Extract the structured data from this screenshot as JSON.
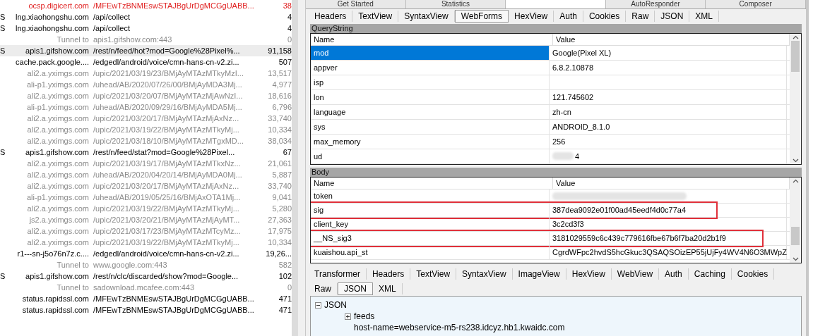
{
  "sessions": [
    {
      "host": "ocsp.digicert.com",
      "url": "/MFEwTzBNMEswSTAJBgUrDgMCGgUABB...",
      "column_4": "38",
      "kind": "error",
      "selected": false
    },
    {
      "column_1": "S",
      "host": "lng.xiaohongshu.com",
      "url": "/api/collect",
      "column_4": "4",
      "kind": "normal",
      "selected": false
    },
    {
      "column_1": "S",
      "host": "lng.xiaohongshu.com",
      "url": "/api/collect",
      "column_4": "4",
      "kind": "normal",
      "selected": false
    },
    {
      "host": "Tunnel to",
      "url": "apis1.gifshow.com:443",
      "column_4": "0",
      "kind": "tunnel",
      "selected": false
    },
    {
      "column_1": "S",
      "host": "apis1.gifshow.com",
      "url": "/rest/n/feed/hot?mod=Google%28Pixel%...",
      "column_4": "91,158",
      "kind": "normal",
      "selected": true
    },
    {
      "host": "cache.pack.google....",
      "url": "/edgedl/android/voice/cmn-hans-cn-v2.zi...",
      "column_4": "507",
      "kind": "normal",
      "selected": false
    },
    {
      "host": "ali2.a.yximgs.com",
      "url": "/upic/2021/03/19/23/BMjAyMTAzMTkyMzI...",
      "column_4": "13,517",
      "kind": "image",
      "selected": false
    },
    {
      "host": "ali-p1.yximgs.com",
      "url": "/uhead/AB/2020/07/26/00/BMjAyMDA3Mj...",
      "column_4": "4,977",
      "kind": "image",
      "selected": false
    },
    {
      "host": "ali2.a.yximgs.com",
      "url": "/upic/2021/03/20/07/BMjAyMTAzMjAwNzI...",
      "column_4": "18,616",
      "kind": "image",
      "selected": false
    },
    {
      "host": "ali-p1.yximgs.com",
      "url": "/uhead/AB/2020/09/29/16/BMjAyMDA5Mj...",
      "column_4": "6,796",
      "kind": "image",
      "selected": false
    },
    {
      "host": "ali2.a.yximgs.com",
      "url": "/upic/2021/03/20/17/BMjAyMTAzMjAxNz...",
      "column_4": "33,740",
      "kind": "image",
      "selected": false
    },
    {
      "host": "ali2.a.yximgs.com",
      "url": "/upic/2021/03/19/22/BMjAyMTAzMTkyMj...",
      "column_4": "10,334",
      "kind": "image",
      "selected": false
    },
    {
      "host": "ali2.a.yximgs.com",
      "url": "/upic/2021/03/18/10/BMjAyMTAzMTgxMD...",
      "column_4": "38,034",
      "kind": "image",
      "selected": false
    },
    {
      "column_1": "S",
      "host": "apis1.gifshow.com",
      "url": "/rest/n/feed/stat?mod=Google%28Pixel...",
      "column_4": "67",
      "kind": "normal",
      "selected": false
    },
    {
      "host": "ali2.a.yximgs.com",
      "url": "/upic/2021/03/19/17/BMjAyMTAzMTkxNz...",
      "column_4": "21,061",
      "kind": "image",
      "selected": false
    },
    {
      "host": "ali2.a.yximgs.com",
      "url": "/uhead/AB/2020/04/20/14/BMjAyMDA0Mj...",
      "column_4": "5,887",
      "kind": "image",
      "selected": false
    },
    {
      "host": "ali2.a.yximgs.com",
      "url": "/upic/2021/03/20/17/BMjAyMTAzMjAxNz...",
      "column_4": "33,740",
      "kind": "image",
      "selected": false
    },
    {
      "host": "ali-p1.yximgs.com",
      "url": "/uhead/AB/2019/05/25/16/BMjAxOTA1Mj...",
      "column_4": "9,041",
      "kind": "image",
      "selected": false
    },
    {
      "host": "ali2.a.yximgs.com",
      "url": "/upic/2021/03/19/22/BMjAyMTAzMTkyMj...",
      "column_4": "5,280",
      "kind": "image",
      "selected": false
    },
    {
      "host": "js2.a.yximgs.com",
      "url": "/upic/2021/03/20/21/BMjAyMTAzMjAyMT...",
      "column_4": "27,363",
      "kind": "image",
      "selected": false
    },
    {
      "host": "ali2.a.yximgs.com",
      "url": "/upic/2021/03/17/23/BMjAyMTAzMTcyMz...",
      "column_4": "17,975",
      "kind": "image",
      "selected": false
    },
    {
      "host": "ali2.a.yximgs.com",
      "url": "/upic/2021/03/19/22/BMjAyMTAzMTkyMj...",
      "column_4": "10,334",
      "kind": "image",
      "selected": false
    },
    {
      "host": "r1---sn-j5o76n7z.c....",
      "url": "/edgedl/android/voice/cmn-hans-cn-v2.zi...",
      "column_4": "19,26...",
      "kind": "normal",
      "selected": false
    },
    {
      "host": "Tunnel to",
      "url": "www.google.com:443",
      "column_4": "582",
      "kind": "tunnel",
      "selected": false
    },
    {
      "column_1": "S",
      "host": "apis1.gifshow.com",
      "url": "/rest/n/clc/discarded/show?mod=Google...",
      "column_4": "102",
      "kind": "normal",
      "selected": false
    },
    {
      "host": "Tunnel to",
      "url": "sadownload.mcafee.com:443",
      "column_4": "0",
      "kind": "tunnel",
      "selected": false
    },
    {
      "host": "status.rapidssl.com",
      "url": "/MFEwTzBNMEswSTAJBgUrDgMCGgUABB...",
      "column_4": "471",
      "kind": "normal",
      "selected": false
    },
    {
      "host": "status.rapidssl.com",
      "url": "/MFEwTzBNMEswSTAJBgUrDgMCGgUABB...",
      "column_4": "471",
      "kind": "normal",
      "selected": false
    }
  ],
  "main_tabs": [
    {
      "label": "Get Started",
      "selected": false
    },
    {
      "label": "Statistics",
      "selected": false
    },
    {
      "selected": true
    },
    {
      "label": "AutoResponder",
      "selected": false
    },
    {
      "label": "Composer",
      "selected": false
    }
  ],
  "request_tabs": [
    {
      "label": "Headers",
      "selected": false
    },
    {
      "label": "TextView",
      "selected": false
    },
    {
      "label": "SyntaxView",
      "selected": false
    },
    {
      "label": "WebForms",
      "selected": true
    },
    {
      "label": "HexView",
      "selected": false
    },
    {
      "label": "Auth",
      "selected": false
    },
    {
      "label": "Cookies",
      "selected": false
    },
    {
      "label": "Raw",
      "selected": false
    },
    {
      "label": "JSON",
      "selected": false
    },
    {
      "label": "XML",
      "selected": false
    }
  ],
  "query_string": {
    "title": "QueryString",
    "columns": [
      "Name",
      "Value"
    ],
    "rows": [
      {
        "name": "mod",
        "value": "Google(Pixel XL)",
        "selected": true
      },
      {
        "name": "appver",
        "value": "6.8.2.10878",
        "selected": false
      },
      {
        "name": "isp",
        "selected": false
      },
      {
        "name": "lon",
        "value": "121.745602",
        "selected": false
      },
      {
        "name": "language",
        "value": "zh-cn",
        "selected": false
      },
      {
        "name": "sys",
        "value": "ANDROID_8.1.0",
        "selected": false
      },
      {
        "name": "max_memory",
        "value": "256",
        "selected": false
      },
      {
        "name": "ud",
        "value": "4",
        "selected": false,
        "redacted": true
      }
    ]
  },
  "body": {
    "title": "Body",
    "columns": [
      "Name",
      "Value"
    ],
    "rows": [
      {
        "name": "token",
        "selected": false,
        "redacted": true
      },
      {
        "name": "sig",
        "value": "387dea9092e01f00ad45eedf4d0c77a4",
        "selected": false,
        "highlighted": true
      },
      {
        "name": "client_key",
        "value": "3c2cd3f3",
        "selected": false
      },
      {
        "name": "__NS_sig3",
        "value": "3181029559c6c439c779616fbe67b6f7ba20d2b1f9",
        "selected": false,
        "highlighted": true
      },
      {
        "name": "kuaishou.api_st",
        "value": "CgrdWFpc2hvdS5hcGkuc3QSAQSOizEP55jUjFy4WV4N6O3MWpZ",
        "selected": false
      }
    ]
  },
  "response_tabs": [
    {
      "label": "Transformer",
      "selected": false
    },
    {
      "label": "Headers",
      "selected": false
    },
    {
      "label": "TextView",
      "selected": false
    },
    {
      "label": "SyntaxView",
      "selected": false
    },
    {
      "label": "ImageView",
      "selected": false
    },
    {
      "label": "HexView",
      "selected": false
    },
    {
      "label": "WebView",
      "selected": false
    },
    {
      "label": "Auth",
      "selected": false
    },
    {
      "label": "Caching",
      "selected": false
    },
    {
      "label": "Cookies",
      "selected": false
    }
  ],
  "response_tabs_2": [
    {
      "label": "Raw",
      "selected": false
    },
    {
      "label": "JSON",
      "selected": true
    },
    {
      "label": "XML",
      "selected": false
    }
  ],
  "json_tree": [
    {
      "label": "JSON",
      "expanded": true,
      "children": [
        {
          "label": "feeds",
          "expanded": false
        },
        {
          "label": "host-name=webservice-m5-rs238.idcyz.hb1.kwaidc.com"
        }
      ]
    }
  ]
}
